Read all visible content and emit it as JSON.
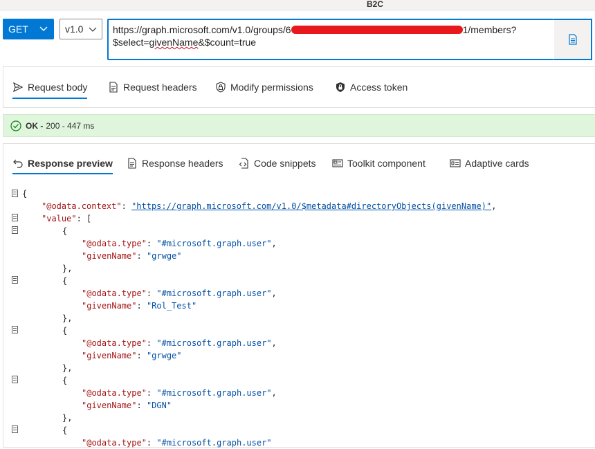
{
  "top": {
    "partial_title": "B2C"
  },
  "request": {
    "method": "GET",
    "version": "v1.0",
    "url_prefix": "https://graph.microsoft.com/v1.0/groups/6",
    "url_suffix": "1/members?",
    "url_line2_a": "$select=",
    "url_line2_squiggle": "givenName",
    "url_line2_b": "&$count=true"
  },
  "request_tabs": [
    {
      "label": "Request body",
      "icon": "send-icon",
      "active": true
    },
    {
      "label": "Request headers",
      "icon": "document-list-icon"
    },
    {
      "label": "Modify permissions",
      "icon": "shield-lock-icon"
    },
    {
      "label": "Access token",
      "icon": "lock-icon"
    }
  ],
  "status": {
    "ok": "OK -",
    "detail": "200 - 447 ms",
    "color": "#dff6dd"
  },
  "response_tabs": [
    {
      "label": "Response preview",
      "icon": "undo-icon",
      "active": true
    },
    {
      "label": "Response headers",
      "icon": "document-list-icon"
    },
    {
      "label": "Code snippets",
      "icon": "code-snippet-icon"
    },
    {
      "label": "Toolkit component",
      "icon": "toolkit-icon"
    },
    {
      "label": "Adaptive cards",
      "icon": "card-icon"
    }
  ],
  "json": {
    "open_brace": "{",
    "context_key": "\"@odata.context\"",
    "context_value": "\"https://graph.microsoft.com/v1.0/$metadata#directoryObjects(givenName)\"",
    "value_key": "\"value\"",
    "type_key": "\"@odata.type\"",
    "given_key": "\"givenName\"",
    "user_type": "\"#microsoft.graph.user\"",
    "items": [
      {
        "givenName": "\"grwge\""
      },
      {
        "givenName": "\"Rol_Test\""
      },
      {
        "givenName": "\"grwge\""
      },
      {
        "givenName": "\"DGN\""
      }
    ]
  },
  "colors": {
    "accent": "#0078d4",
    "json_key": "#a31515",
    "json_string": "#0451a5"
  }
}
